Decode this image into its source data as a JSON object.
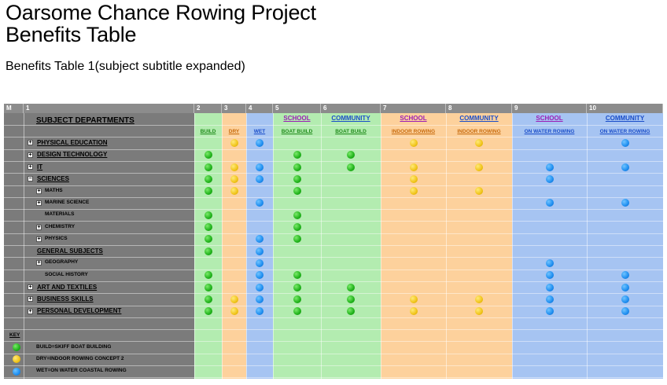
{
  "page": {
    "title_line1": "Oarsome Chance Rowing Project",
    "title_line2": "Benefits Table",
    "subtitle": "Benefits Table 1(subject subtitle expanded)"
  },
  "columns": {
    "numbers": [
      "M",
      "1",
      "2",
      "3",
      "4",
      "5",
      "6",
      "7",
      "8",
      "9",
      "10"
    ],
    "groups": [
      "SCHOOL",
      "COMMUNITY",
      "SCHOOL",
      "COMMUNITY",
      "SCHOOL",
      "COMMUNITY"
    ],
    "sub": [
      "BUILD",
      "DRY",
      "WET",
      "BOAT BUILD",
      "BOAT BUILD",
      "INDOOR ROWING",
      "INDOOR ROWING",
      "ON WATER ROWING",
      "ON WATER ROWING"
    ]
  },
  "header_label": "SUBJECT DEPARTMENTS",
  "rows": [
    {
      "label": "PHYSICAL EDUCATION",
      "level": 0,
      "icon": "plus",
      "dots": [
        0,
        1,
        1,
        0,
        0,
        1,
        1,
        0,
        1
      ]
    },
    {
      "label": "DESIGN TECHNOLOGY",
      "level": 0,
      "icon": "plus",
      "dots": [
        1,
        0,
        0,
        1,
        1,
        0,
        0,
        0,
        0
      ]
    },
    {
      "label": "IT",
      "level": 0,
      "icon": "plus",
      "dots": [
        1,
        1,
        1,
        1,
        1,
        1,
        1,
        1,
        1
      ]
    },
    {
      "label": "SCIENCES",
      "level": 0,
      "icon": "minus",
      "dots": [
        1,
        1,
        1,
        1,
        0,
        1,
        0,
        1,
        0
      ]
    },
    {
      "label": "MATHS",
      "level": 1,
      "icon": "plus",
      "dots": [
        1,
        1,
        0,
        1,
        0,
        1,
        1,
        0,
        0
      ]
    },
    {
      "label": "MARINE SCIENCE",
      "level": 1,
      "icon": "plus",
      "dots": [
        0,
        0,
        1,
        0,
        0,
        0,
        0,
        1,
        1
      ]
    },
    {
      "label": "MATERIALS",
      "level": 1,
      "icon": "none",
      "dots": [
        1,
        0,
        0,
        1,
        0,
        0,
        0,
        0,
        0
      ]
    },
    {
      "label": "CHEMISTRY",
      "level": 1,
      "icon": "plus",
      "dots": [
        1,
        0,
        0,
        1,
        0,
        0,
        0,
        0,
        0
      ]
    },
    {
      "label": "PHYSICS",
      "level": 1,
      "icon": "plus",
      "dots": [
        1,
        0,
        1,
        1,
        0,
        0,
        0,
        0,
        0
      ]
    },
    {
      "label": "GENERAL SUBJECTS",
      "level": 0,
      "icon": "none",
      "dots": [
        1,
        0,
        1,
        0,
        0,
        0,
        0,
        0,
        0
      ]
    },
    {
      "label": "GEOGRAPHY",
      "level": 1,
      "icon": "plus",
      "dots": [
        0,
        0,
        1,
        0,
        0,
        0,
        0,
        1,
        0
      ]
    },
    {
      "label": "SOCIAL HISTORY",
      "level": 1,
      "icon": "none",
      "dots": [
        1,
        0,
        1,
        1,
        0,
        0,
        0,
        1,
        1
      ]
    },
    {
      "label": "ART AND TEXTILES",
      "level": 0,
      "icon": "plus",
      "dots": [
        1,
        0,
        1,
        1,
        1,
        0,
        0,
        1,
        1
      ]
    },
    {
      "label": "BUSINESS SKILLS",
      "level": 0,
      "icon": "plus",
      "dots": [
        1,
        1,
        1,
        1,
        1,
        1,
        1,
        1,
        1
      ]
    },
    {
      "label": "PERSONAL DEVELOPMENT",
      "level": 0,
      "icon": "plus",
      "dots": [
        1,
        1,
        1,
        1,
        1,
        1,
        1,
        1,
        1
      ]
    }
  ],
  "key": {
    "title": "KEY",
    "items": [
      {
        "color": "green",
        "label": "BUILD=SKIFF BOAT BUILDING"
      },
      {
        "color": "yellow",
        "label": "DRY=INDOOR ROWING CONCEPT 2"
      },
      {
        "color": "blue",
        "label": "WET=ON WATER COASTAL ROWING"
      }
    ]
  },
  "colors": {
    "green_col": "#b3ecb0",
    "orange_col": "#fdd19c",
    "blue_col": "#a6c4f2",
    "left_gray": "#7b7b7b",
    "header_gray": "#8c8c8c",
    "group_school": "#9b1fb5",
    "group_community": "#1a4dc9",
    "sub_green": "#1f8a1a",
    "sub_orange": "#c76a0c",
    "sub_blue": "#1a4dc9"
  }
}
